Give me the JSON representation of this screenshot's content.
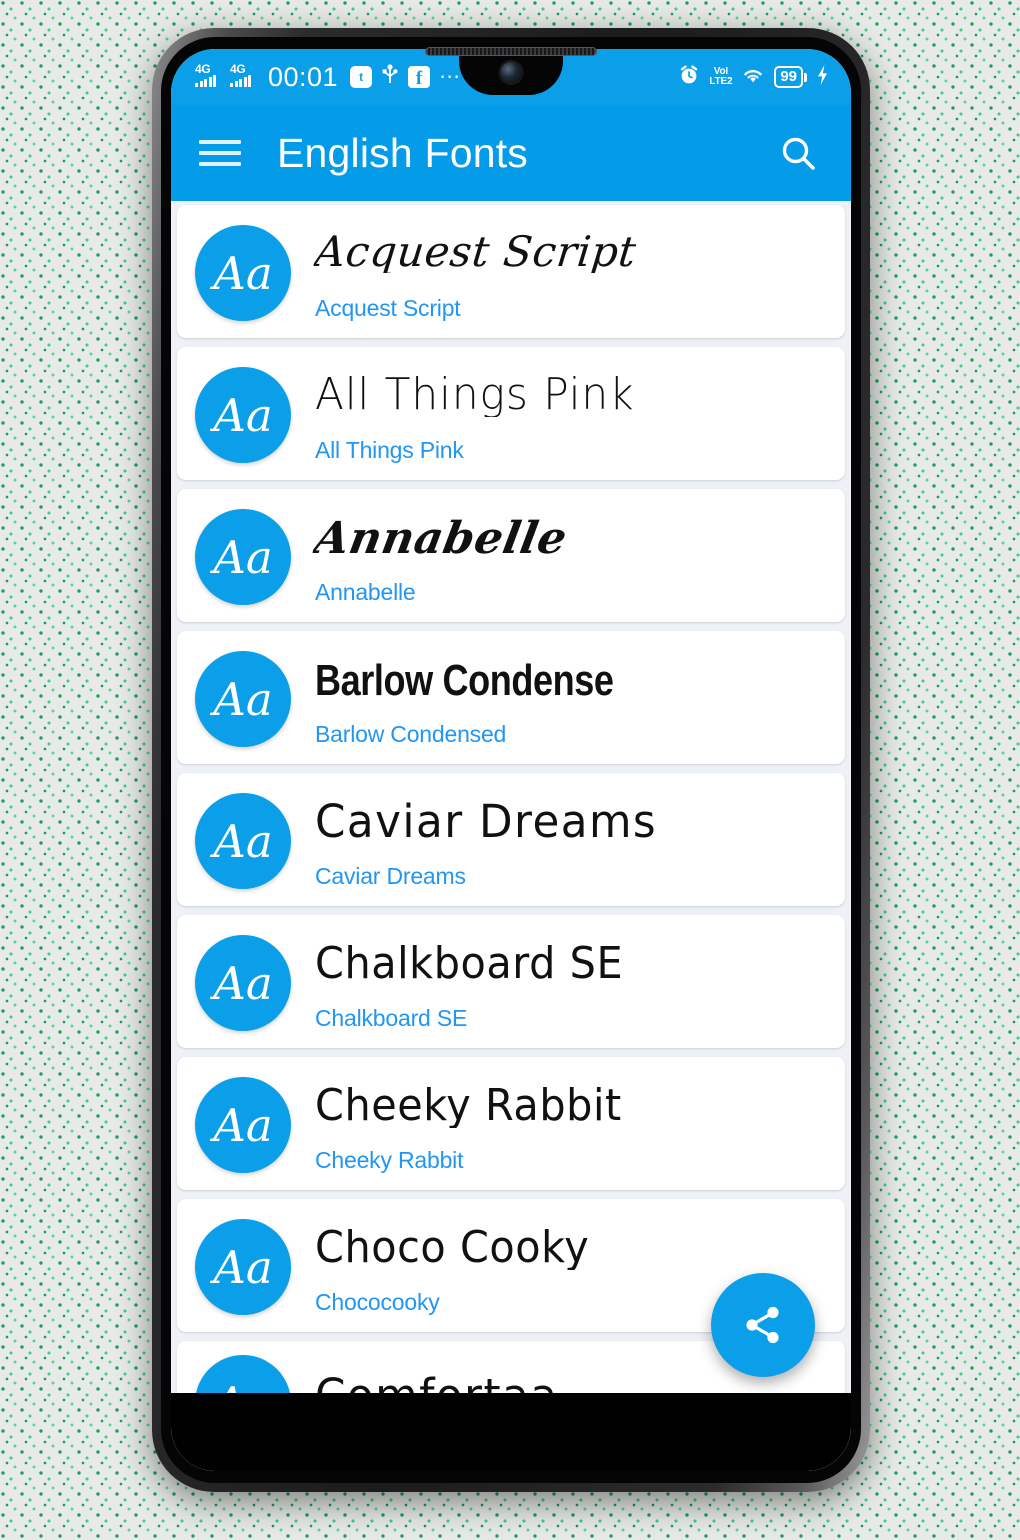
{
  "status_bar": {
    "network_1": "4G",
    "network_2": "4G",
    "clock": "00:01",
    "app_badge": "t",
    "usb_icon_name": "usb-icon",
    "facebook_icon_label": "f",
    "overflow": "⋯",
    "alarm_icon_name": "alarm-clock-icon",
    "volte_top": "VoI",
    "volte_bottom": "LTE2",
    "wifi_icon_name": "wifi-icon",
    "battery_level": "99",
    "charging_icon_name": "charging-bolt-icon"
  },
  "app_bar": {
    "menu_icon_name": "hamburger-menu-icon",
    "title": "English Fonts",
    "search_icon_name": "search-icon"
  },
  "fab": {
    "icon_name": "share-icon",
    "label": "Share"
  },
  "list": {
    "avatar_text": "Aa",
    "items": [
      {
        "preview": "Acquest Script",
        "label": "Acquest Script",
        "style": "f-script"
      },
      {
        "preview": "All Things Pink",
        "label": "All Things Pink",
        "style": "f-thin"
      },
      {
        "preview": "Annabelle",
        "label": "Annabelle",
        "style": "f-calli"
      },
      {
        "preview": "Barlow Condense",
        "label": "Barlow Condensed",
        "style": "f-condensed"
      },
      {
        "preview": "Caviar Dreams",
        "label": "Caviar Dreams",
        "style": "f-round"
      },
      {
        "preview": "Chalkboard SE",
        "label": "Chalkboard SE",
        "style": "f-hand"
      },
      {
        "preview": "Cheeky Rabbit",
        "label": "Cheeky Rabbit",
        "style": "f-hand"
      },
      {
        "preview": "Choco Cooky",
        "label": "Chococooky",
        "style": "f-hand"
      },
      {
        "preview": "Comfortaa",
        "label": "",
        "style": "f-round"
      }
    ]
  },
  "colors": {
    "accent_blue": "#0c9fe9",
    "app_bar_blue": "#049be8",
    "label_blue": "#2196f3",
    "list_background": "#eef1f5",
    "card_white": "#ffffff",
    "wallpaper_base": "#e7eae6",
    "wallpaper_accent": "#18a05a"
  }
}
